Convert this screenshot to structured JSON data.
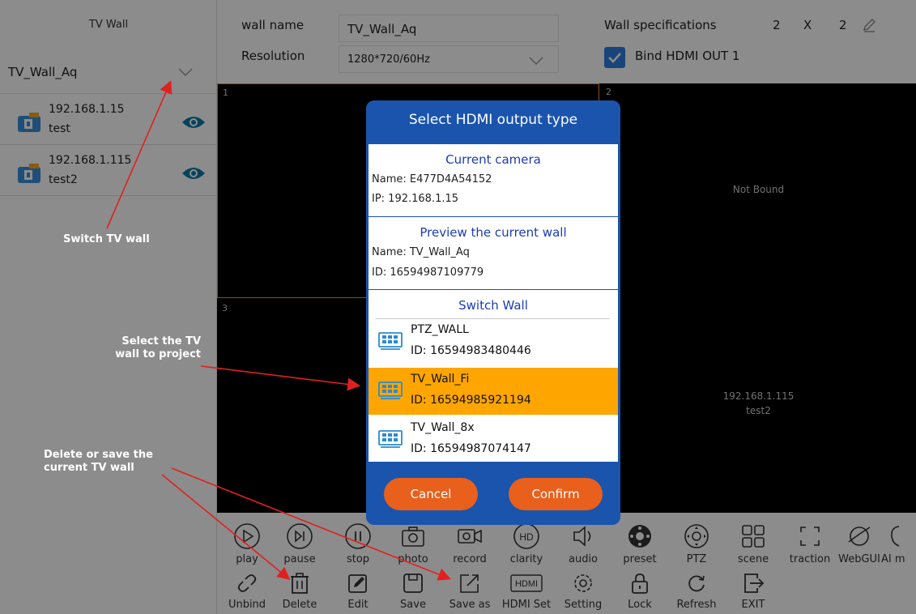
{
  "sidebar": {
    "title": "TV Wall",
    "selected_wall": "TV_Wall_Aq",
    "cameras": [
      {
        "ip": "192.168.1.15",
        "name": "test"
      },
      {
        "ip": "192.168.1.115",
        "name": "test2"
      }
    ]
  },
  "header": {
    "wall_name_label": "wall name",
    "wall_name_value": "TV_Wall_Aq",
    "resolution_label": "Resolution",
    "resolution_value": "1280*720/60Hz",
    "spec_label": "Wall specifications",
    "spec_rows": "2",
    "spec_x": "X",
    "spec_cols": "2",
    "bind_label": "Bind HDMI OUT 1",
    "bind_checked": true
  },
  "grid": {
    "cells": [
      {
        "num": "1",
        "text": ""
      },
      {
        "num": "2",
        "text": "Not Bound"
      },
      {
        "num": "3",
        "text": ""
      },
      {
        "num": "",
        "text": "192.168.1.115",
        "text2": "test2"
      }
    ]
  },
  "toolbar": {
    "row1": [
      "play",
      "pause",
      "stop",
      "photo",
      "record",
      "clarity",
      "audio",
      "preset",
      "PTZ",
      "scene",
      "traction",
      "WebGUI",
      "AI m"
    ],
    "row2": [
      "Unbind",
      "Delete",
      "Edit",
      "Save",
      "Save as",
      "HDMI Set",
      "Setting",
      "Lock",
      "Refresh",
      "EXIT"
    ],
    "hdmi_icon_text": "HDMI"
  },
  "dialog": {
    "title": "Select HDMI output type",
    "camera": {
      "title": "Current camera",
      "name": "Name: E477D4A54152",
      "ip": "IP: 192.168.1.15"
    },
    "preview": {
      "title": "Preview the current wall",
      "name": "Name: TV_Wall_Aq",
      "id": "ID: 16594987109779"
    },
    "switch_title": "Switch Wall",
    "walls": [
      {
        "name": "PTZ_WALL",
        "id": "ID: 16594983480446",
        "selected": false
      },
      {
        "name": "TV_Wall_Fi",
        "id": "ID: 16594985921194",
        "selected": true
      },
      {
        "name": "TV_Wall_8x",
        "id": "ID: 16594987074147",
        "selected": false
      }
    ],
    "cancel": "Cancel",
    "confirm": "Confirm"
  },
  "annotations": {
    "switch": "Switch TV wall",
    "select_line1": "Select the TV",
    "select_line2": "wall to project",
    "delete_line1": "Delete or save the",
    "delete_line2": "current TV wall"
  },
  "colors": {
    "accent_blue": "#1a54ad",
    "selected_orange": "#ffa500",
    "button_orange": "#e8601c",
    "eye_teal": "#0a7aa6",
    "arrow_red": "#e02020"
  }
}
